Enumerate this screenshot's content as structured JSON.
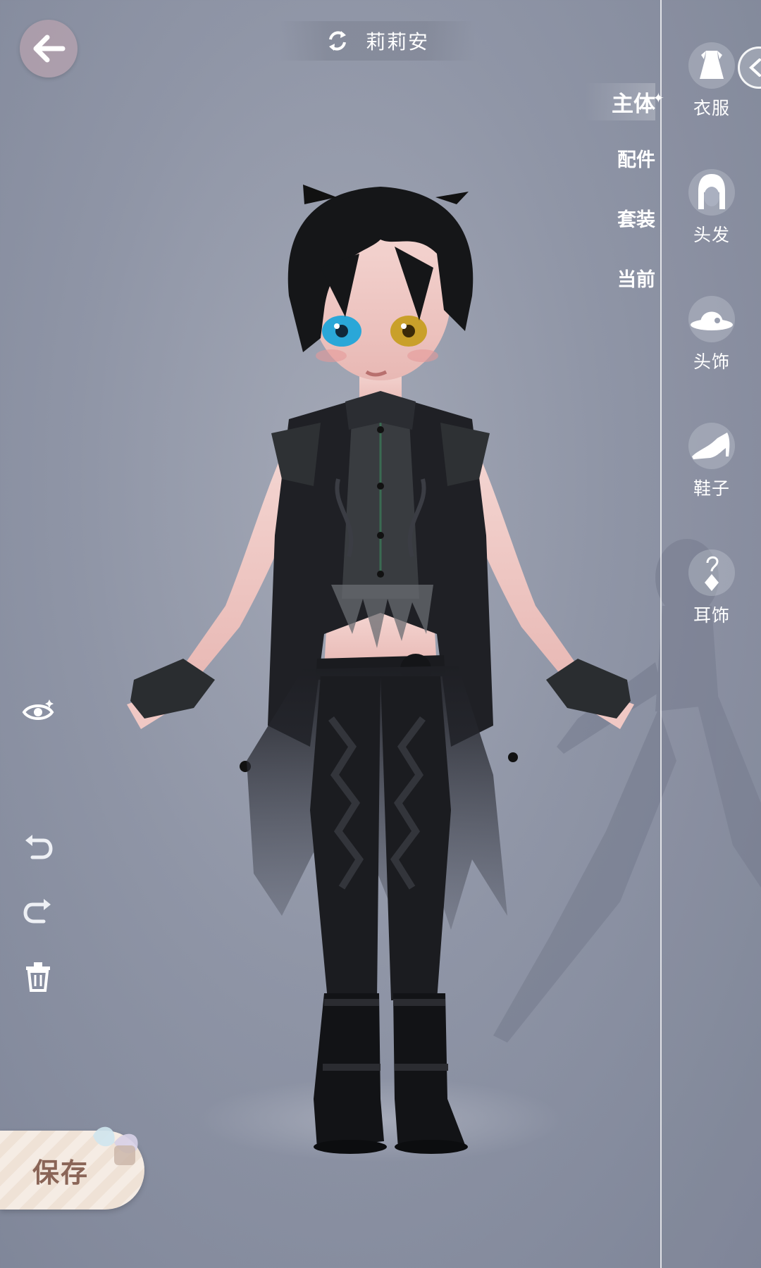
{
  "header": {
    "character_name": "莉莉安"
  },
  "sub_tabs": [
    {
      "label": "主体",
      "active": true
    },
    {
      "label": "配件",
      "active": false
    },
    {
      "label": "套装",
      "active": false
    },
    {
      "label": "当前",
      "active": false
    }
  ],
  "categories": [
    {
      "label": "衣服",
      "icon": "dress-icon"
    },
    {
      "label": "头发",
      "icon": "hair-icon"
    },
    {
      "label": "头饰",
      "icon": "hat-icon"
    },
    {
      "label": "鞋子",
      "icon": "high-heel-icon"
    },
    {
      "label": "耳饰",
      "icon": "earring-icon"
    }
  ],
  "tools": [
    {
      "name": "visibility-toggle",
      "icon": "eye-icon"
    },
    {
      "name": "undo",
      "icon": "undo-icon"
    },
    {
      "name": "redo",
      "icon": "redo-icon"
    },
    {
      "name": "delete",
      "icon": "trash-icon"
    }
  ],
  "save": {
    "label": "保存"
  },
  "colors": {
    "background": "#8f95a6",
    "panel_line": "#ffffff",
    "save_text": "#8a6557",
    "back_button": "#c8aab4"
  }
}
